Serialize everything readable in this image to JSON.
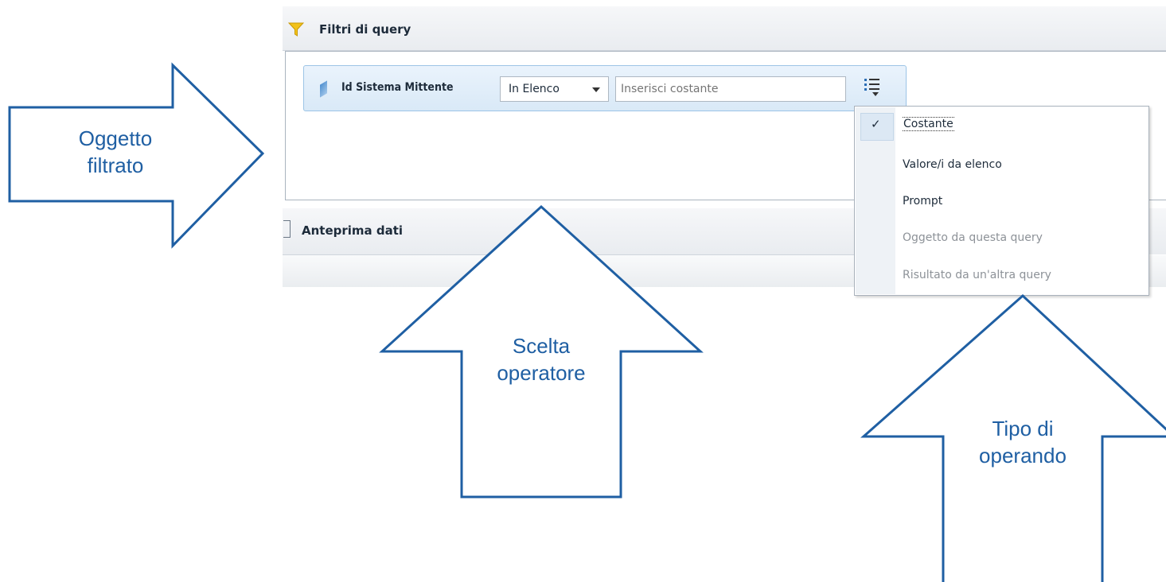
{
  "filters_panel": {
    "title": "Filtri di query",
    "filter": {
      "object_name": "Id Sistema Mittente",
      "operator": "In Elenco",
      "operand_placeholder": "Inserisci costante"
    }
  },
  "operand_menu": {
    "items": [
      {
        "label": "Costante",
        "selected": true,
        "enabled": true
      },
      {
        "label": "Valore/i da elenco",
        "selected": false,
        "enabled": true
      },
      {
        "label": "Prompt",
        "selected": false,
        "enabled": true
      },
      {
        "label": "Oggetto da questa query",
        "selected": false,
        "enabled": false
      },
      {
        "label": "Risultato da un'altra query",
        "selected": false,
        "enabled": false
      }
    ]
  },
  "preview_panel": {
    "title": "Anteprima dati"
  },
  "callouts": {
    "filtered_object": {
      "line1": "Oggetto",
      "line2": "filtrato"
    },
    "operator_choice": {
      "line1": "Scelta",
      "line2": "operatore"
    },
    "operand_type": {
      "line1": "Tipo di",
      "line2": "operando"
    }
  },
  "colors": {
    "callout_stroke": "#1f5fa3",
    "funnel": "#f2c21b",
    "selected_bg": "#dce8f4"
  }
}
